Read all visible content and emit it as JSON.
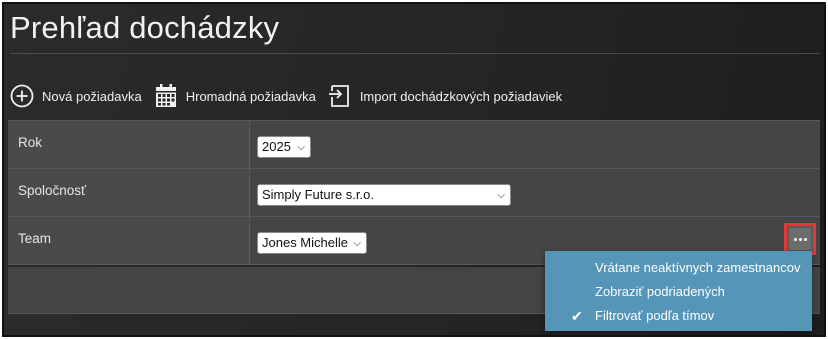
{
  "page": {
    "title": "Prehľad dochádzky"
  },
  "toolbar": {
    "new_request": {
      "label": "Nová požiadavka",
      "icon": "plus-circle-icon"
    },
    "bulk_request": {
      "label": "Hromadná požiadavka",
      "icon": "calendar-icon"
    },
    "import_requests": {
      "label": "Import dochádzkových požiadaviek",
      "icon": "import-icon"
    }
  },
  "filters": {
    "year": {
      "label": "Rok",
      "value": "2025"
    },
    "company": {
      "label": "Spoločnosť",
      "value": "Simply Future s.r.o."
    },
    "team": {
      "label": "Team",
      "value": "Jones Michelle"
    }
  },
  "options_menu": {
    "items": [
      {
        "label": "Vrátane neaktívnych zamestnancov",
        "checked": false
      },
      {
        "label": "Zobraziť podriadených",
        "checked": false
      },
      {
        "label": "Filtrovať podľa tímov",
        "checked": true
      }
    ]
  },
  "colors": {
    "menu_bg": "#5495b8",
    "highlight_border": "#e03a3a"
  }
}
